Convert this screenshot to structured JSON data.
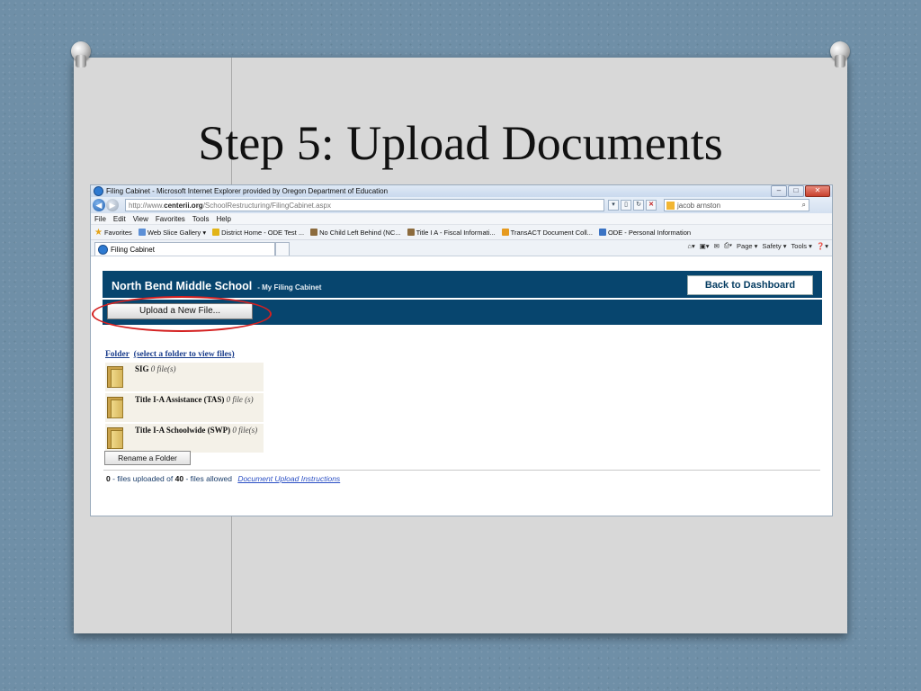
{
  "slide": {
    "title": "Step 5:  Upload Documents"
  },
  "browser": {
    "window_title": "Filing Cabinet - Microsoft Internet Explorer provided by Oregon Department of Education",
    "url_prefix": "http://www.",
    "url_domain": "centerii.org",
    "url_path": "/SchoolRestructuring/FilingCabinet.aspx",
    "search_text": "jacob arnston",
    "menu": [
      "File",
      "Edit",
      "View",
      "Favorites",
      "Tools",
      "Help"
    ],
    "favorites_label": "Favorites",
    "favorites": [
      {
        "label": "Web Slice Gallery ▾",
        "color": "#5b8fd6"
      },
      {
        "label": "District Home - ODE Test ...",
        "color": "#e2b417"
      },
      {
        "label": "No Child Left Behind (NC...",
        "color": "#8c6b3d"
      },
      {
        "label": "Title I A - Fiscal Informati...",
        "color": "#8c6b3d"
      },
      {
        "label": "TransACT Document Coll...",
        "color": "#e69a1f"
      },
      {
        "label": "ODE - Personal Information",
        "color": "#3a73c4"
      }
    ],
    "tab_label": "Filing Cabinet",
    "command_bar": [
      "Page ▾",
      "Safety ▾",
      "Tools ▾"
    ]
  },
  "app": {
    "school_name": "North Bend Middle School",
    "section": "- My Filing Cabinet",
    "dashboard_button": "Back to Dashboard",
    "upload_button": "Upload a New File...",
    "folder_label": "Folder",
    "folder_hint": "(select a folder to view files)",
    "folders": [
      {
        "name": "SIG",
        "count": "0 file(s)"
      },
      {
        "name": "Title I-A Assistance (TAS)",
        "count": "0 file (s)"
      },
      {
        "name": "Title I-A Schoolwide (SWP)",
        "count": "0 file(s)"
      }
    ],
    "rename_button": "Rename a Folder",
    "status": {
      "uploaded": "0",
      "uploaded_text": "- files uploaded of",
      "allowed": "40",
      "allowed_text": "- files allowed",
      "instructions_link": "Document Upload Instructions"
    }
  }
}
